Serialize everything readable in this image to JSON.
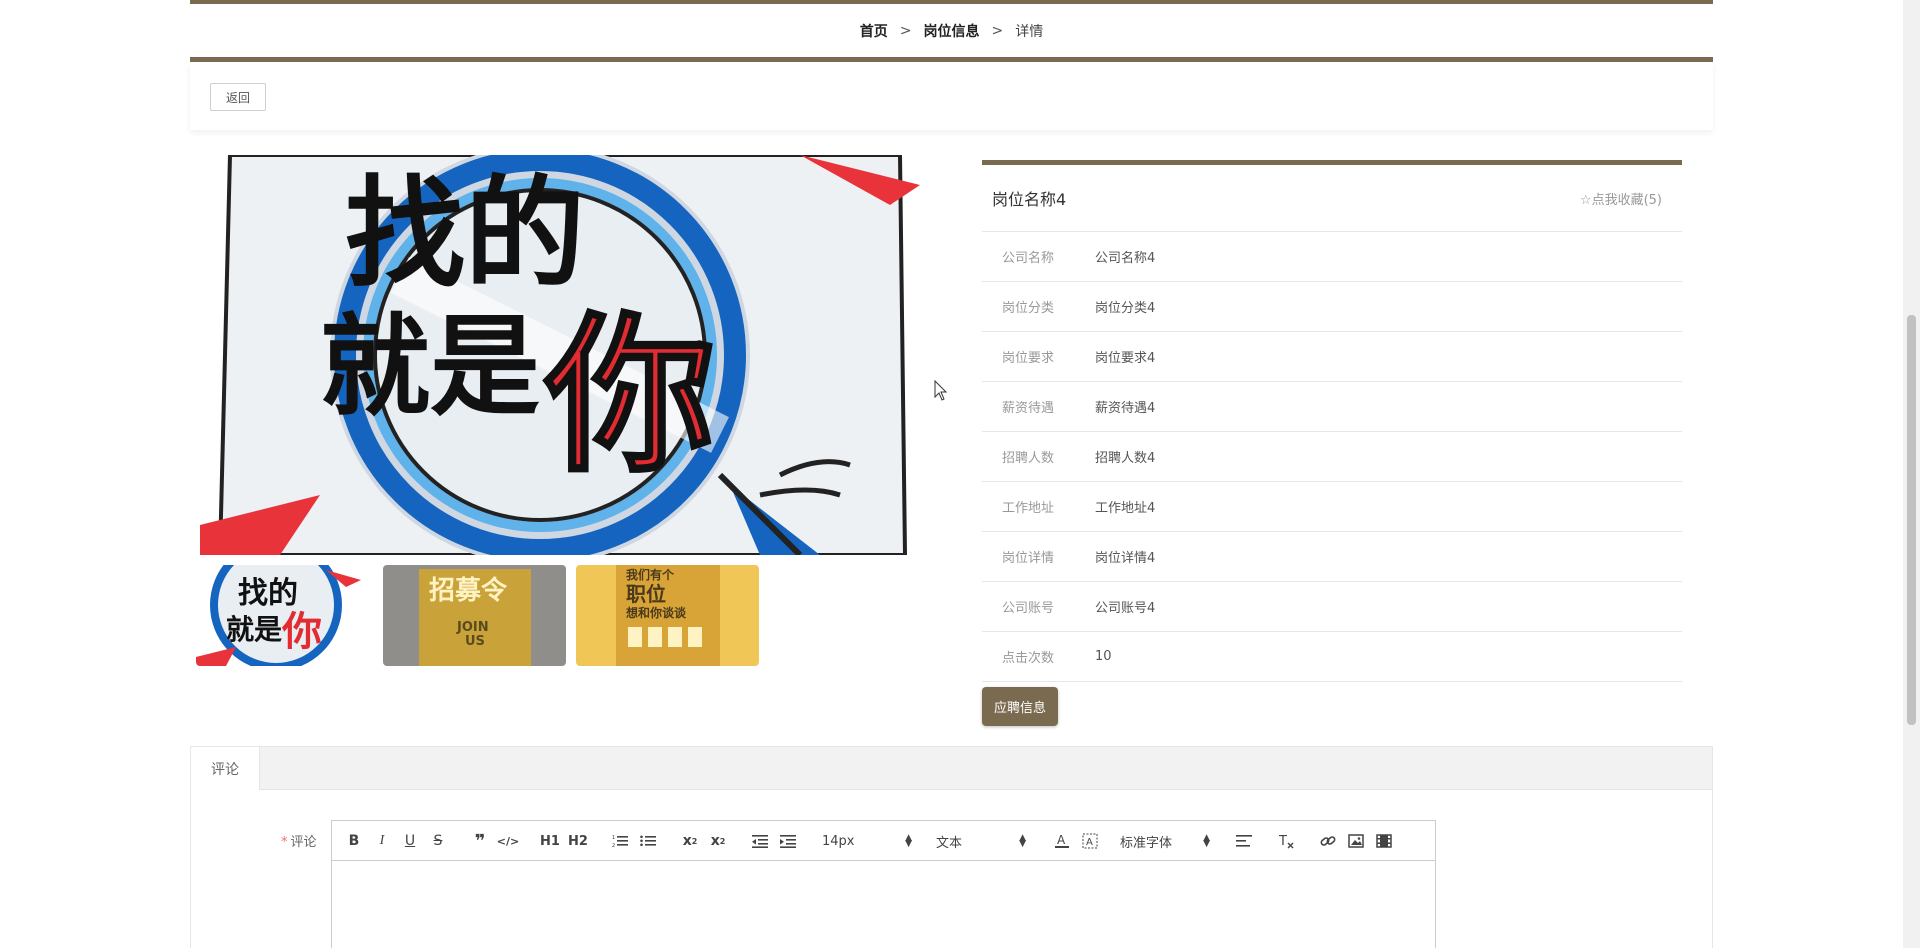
{
  "breadcrumb": {
    "home": "首页",
    "section": "岗位信息",
    "current": "详情",
    "separator": ">"
  },
  "back_label": "返回",
  "detail": {
    "title": "岗位名称4",
    "favorite": "☆点我收藏(5)",
    "fields": [
      {
        "label": "公司名称",
        "value": "公司名称4"
      },
      {
        "label": "岗位分类",
        "value": "岗位分类4"
      },
      {
        "label": "岗位要求",
        "value": "岗位要求4"
      },
      {
        "label": "薪资待遇",
        "value": "薪资待遇4"
      },
      {
        "label": "招聘人数",
        "value": "招聘人数4"
      },
      {
        "label": "工作地址",
        "value": "工作地址4"
      },
      {
        "label": "岗位详情",
        "value": "岗位详情4"
      },
      {
        "label": "公司账号",
        "value": "公司账号4"
      },
      {
        "label": "点击次数",
        "value": "10"
      }
    ]
  },
  "apply_label": "应聘信息",
  "images": {
    "main_text": [
      "找的",
      "就是",
      "你"
    ],
    "thumb2_text": [
      "招募令",
      "JOIN",
      "US"
    ],
    "thumb3_text": [
      "我们有个",
      "职位",
      "想和你谈谈"
    ]
  },
  "comments": {
    "tab": "评论",
    "field_label": "评论",
    "required_mark": "*",
    "editor": {
      "font_size": "14px",
      "format": "文本",
      "font_family": "标准字体",
      "h1": "H1",
      "h2": "H2"
    }
  },
  "colors": {
    "accent": "#7a6a50",
    "required": "#f56c6c"
  }
}
